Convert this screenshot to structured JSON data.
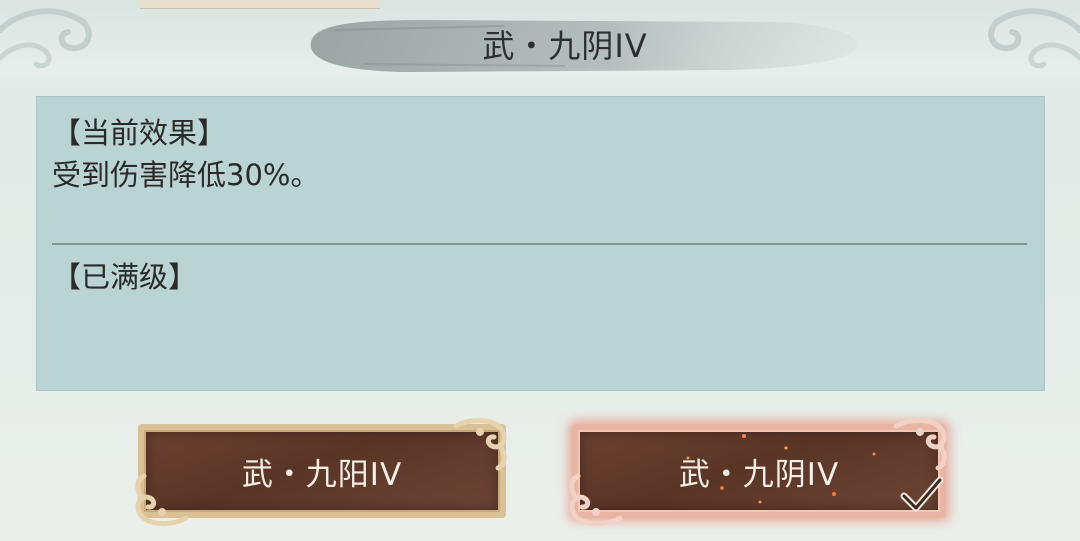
{
  "title": {
    "text": "武・九阴IV"
  },
  "info": {
    "effect_heading": "【当前效果】",
    "effect_text": "受到伤害降低30%。",
    "status_text": "【已满级】"
  },
  "buttons": {
    "left_label": "武・九阳IV",
    "right_label": "武・九阴IV"
  },
  "colors": {
    "panel_bg": "#b9d4d2",
    "button_fill": "#5a3526",
    "button_border_gold": "#d9c195",
    "button_border_selected": "#e9b4a4",
    "text_dark": "#2a2a2a",
    "text_light": "#f4efe6"
  },
  "icons": {
    "left_cloud": "cloud-ornament-icon",
    "right_cloud": "cloud-ornament-icon",
    "selected_marker": "checkmark-icon"
  }
}
